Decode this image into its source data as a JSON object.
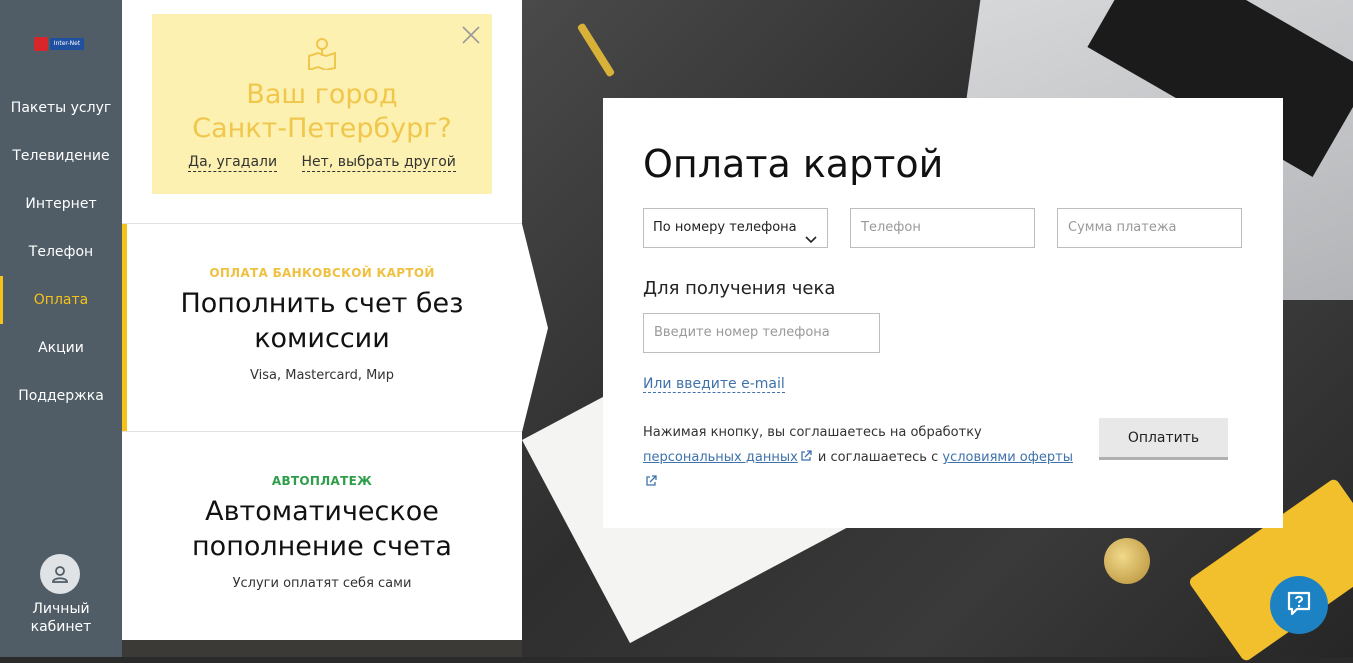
{
  "sidebar": {
    "logo_text": "Inter-Net",
    "items": [
      {
        "label": "Пакеты услуг"
      },
      {
        "label": "Телевидение"
      },
      {
        "label": "Интернет"
      },
      {
        "label": "Телефон"
      },
      {
        "label": "Оплата"
      },
      {
        "label": "Акции"
      },
      {
        "label": "Поддержка"
      }
    ],
    "active_item": "Оплата",
    "cabinet_label_1": "Личный",
    "cabinet_label_2": "кабинет"
  },
  "city_prompt": {
    "title_line1": "Ваш город",
    "title_line2": "Санкт-Петербург?",
    "yes_link": "Да, угадали",
    "no_link": "Нет, выбрать другой"
  },
  "sections": [
    {
      "label": "ОПЛАТА БАНКОВСКОЙ КАРТОЙ",
      "title_line1": "Пополнить счет без",
      "title_line2": "комиссии",
      "subtitle": "Visa, Mastercard, Мир",
      "label_color": "#f0c040"
    },
    {
      "label": "АВТОПЛАТЕЖ",
      "title_line1": "Автоматическое",
      "title_line2": "пополнение счета",
      "subtitle": "Услуги оплатят себя сами",
      "label_color": "#2e9e4a"
    }
  ],
  "payment": {
    "title": "Оплата картой",
    "method_select": "По номеру телефона",
    "phone_placeholder": "Телефон",
    "amount_placeholder": "Сумма платежа",
    "receipt_label": "Для получения чека",
    "receipt_placeholder": "Введите номер телефона",
    "email_link": "Или введите e-mail",
    "agree_text_1": "Нажимая кнопку, вы соглашаетесь на обработку ",
    "agree_link_1": "персональных данных",
    "agree_text_2": " и соглашаетесь с ",
    "agree_link_2": "условиями оферты",
    "pay_button": "Оплатить"
  },
  "colors": {
    "sidebar_bg": "#505c66",
    "accent_yellow": "#f6c21a",
    "link_blue": "#3f72ab",
    "help_blue": "#1d82c4"
  }
}
